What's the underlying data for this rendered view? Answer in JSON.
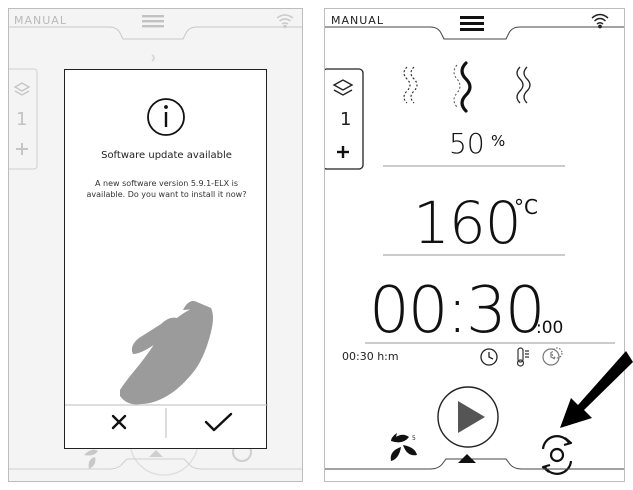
{
  "left_screen": {
    "mode_label": "MANUAL",
    "step_count": "1",
    "dialog": {
      "title": "Software update available",
      "message": "A new software version 5.9.1-ELX is available. Do you want to install it now?",
      "cancel_icon": "close-icon",
      "confirm_icon": "check-icon",
      "info_icon": "info-icon"
    }
  },
  "right_screen": {
    "mode_label": "MANUAL",
    "step_count": "1",
    "humidity": {
      "value": "50",
      "unit": "%"
    },
    "temperature": {
      "value": "160",
      "unit": "°C"
    },
    "timer": {
      "main": "00:30",
      "seconds": ":00",
      "preset": "00:30 h:m"
    },
    "fan_label": "5",
    "icons": [
      "hamburger-menu-icon",
      "wifi-icon",
      "layers-icon",
      "plus-icon",
      "steam-icon",
      "timer-icon",
      "probe-icon",
      "delayed-start-icon",
      "play-icon",
      "fan-icon",
      "settings-rotate-icon"
    ]
  },
  "annotations": {
    "accent": "#000000",
    "hand": "#9b9b9b"
  }
}
